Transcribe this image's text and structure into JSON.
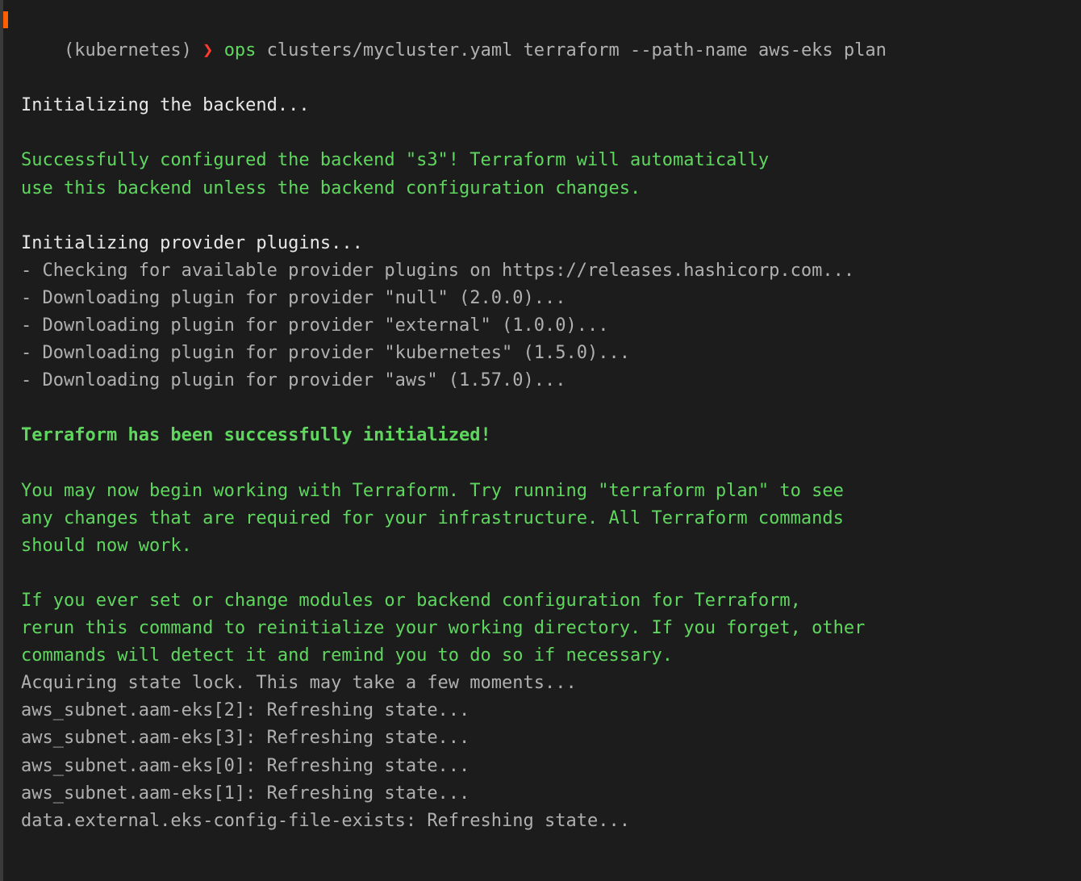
{
  "prompt": {
    "env": "(kubernetes)",
    "arrow": " ❯ ",
    "command": "ops",
    "args": " clusters/mycluster.yaml terraform --path-name aws-eks plan"
  },
  "lines": {
    "init_backend": "Initializing the backend...",
    "s3_success_l1": "Successfully configured the backend \"s3\"! Terraform will automatically",
    "s3_success_l2": "use this backend unless the backend configuration changes.",
    "init_plugins": "Initializing provider plugins...",
    "check_plugins": "- Checking for available provider plugins on https://releases.hashicorp.com...",
    "dl_null": "- Downloading plugin for provider \"null\" (2.0.0)...",
    "dl_external": "- Downloading plugin for provider \"external\" (1.0.0)...",
    "dl_kubernetes": "- Downloading plugin for provider \"kubernetes\" (1.5.0)...",
    "dl_aws": "- Downloading plugin for provider \"aws\" (1.57.0)...",
    "tf_initialized": "Terraform has been successfully initialized!",
    "begin_l1": "You may now begin working with Terraform. Try running \"terraform plan\" to see",
    "begin_l2": "any changes that are required for your infrastructure. All Terraform commands",
    "begin_l3": "should now work.",
    "ifchange_l1": "If you ever set or change modules or backend configuration for Terraform,",
    "ifchange_l2": "rerun this command to reinitialize your working directory. If you forget, other",
    "ifchange_l3": "commands will detect it and remind you to do so if necessary.",
    "acquire_lock": "Acquiring state lock. This may take a few moments...",
    "refresh_subnet2": "aws_subnet.aam-eks[2]: Refreshing state...",
    "refresh_subnet3": "aws_subnet.aam-eks[3]: Refreshing state...",
    "refresh_subnet0": "aws_subnet.aam-eks[0]: Refreshing state...",
    "refresh_subnet1": "aws_subnet.aam-eks[1]: Refreshing state...",
    "refresh_data_ext": "data.external.eks-config-file-exists: Refreshing state..."
  }
}
